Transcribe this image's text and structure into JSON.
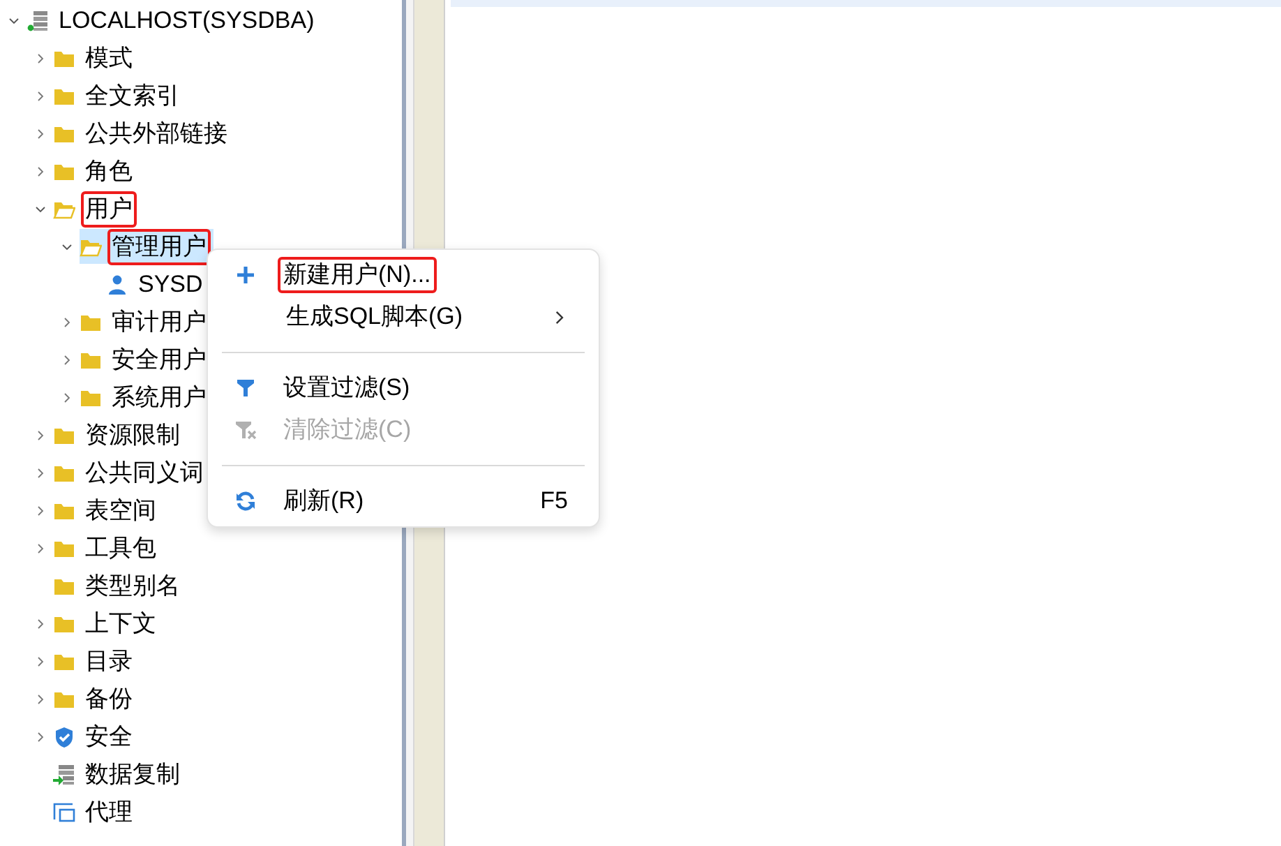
{
  "tree": [
    {
      "label": "LOCALHOST(SYSDBA)",
      "kind": "server",
      "expanded": true,
      "selected": false,
      "annotated": false,
      "children": [
        {
          "label": "模式",
          "kind": "folder",
          "expanded": false,
          "selected": false,
          "annotated": false
        },
        {
          "label": "全文索引",
          "kind": "folder",
          "expanded": false,
          "selected": false,
          "annotated": false
        },
        {
          "label": "公共外部链接",
          "kind": "folder",
          "expanded": false,
          "selected": false,
          "annotated": false
        },
        {
          "label": "角色",
          "kind": "folder",
          "expanded": false,
          "selected": false,
          "annotated": false
        },
        {
          "label": "用户",
          "kind": "folder",
          "expanded": true,
          "selected": false,
          "annotated": true,
          "children": [
            {
              "label": "管理用户",
              "kind": "folder",
              "expanded": true,
              "selected": true,
              "annotated": true,
              "children": [
                {
                  "label": "SYSD",
                  "kind": "user",
                  "selected": false,
                  "annotated": false
                }
              ]
            },
            {
              "label": "审计用户",
              "kind": "folder",
              "expanded": false,
              "selected": false,
              "annotated": false
            },
            {
              "label": "安全用户",
              "kind": "folder",
              "expanded": false,
              "selected": false,
              "annotated": false
            },
            {
              "label": "系统用户",
              "kind": "folder",
              "expanded": false,
              "selected": false,
              "annotated": false
            }
          ]
        },
        {
          "label": "资源限制",
          "kind": "folder",
          "expanded": false,
          "selected": false,
          "annotated": false
        },
        {
          "label": "公共同义词",
          "kind": "folder",
          "expanded": false,
          "selected": false,
          "annotated": false
        },
        {
          "label": "表空间",
          "kind": "folder",
          "expanded": false,
          "selected": false,
          "annotated": false
        },
        {
          "label": "工具包",
          "kind": "folder",
          "expanded": false,
          "selected": false,
          "annotated": false
        },
        {
          "label": "类型别名",
          "kind": "folder",
          "selected": false,
          "annotated": false
        },
        {
          "label": "上下文",
          "kind": "folder",
          "expanded": false,
          "selected": false,
          "annotated": false
        },
        {
          "label": "目录",
          "kind": "folder",
          "expanded": false,
          "selected": false,
          "annotated": false
        },
        {
          "label": "备份",
          "kind": "folder",
          "expanded": false,
          "selected": false,
          "annotated": false
        },
        {
          "label": "安全",
          "kind": "shield",
          "expanded": false,
          "selected": false,
          "annotated": false
        },
        {
          "label": "数据复制",
          "kind": "replication",
          "selected": false,
          "annotated": false
        },
        {
          "label": "代理",
          "kind": "proxy",
          "selected": false,
          "annotated": false
        }
      ]
    }
  ],
  "context_menu": [
    {
      "kind": "command",
      "label": "新建用户(N)...",
      "disabled": false,
      "annotated": true
    },
    {
      "kind": "command",
      "label": "生成SQL脚本(G)",
      "disabled": false,
      "annotated": false,
      "submenu": true
    },
    {
      "kind": "separator"
    },
    {
      "kind": "command",
      "label": "设置过滤(S)",
      "disabled": false,
      "annotated": false
    },
    {
      "kind": "command",
      "label": "清除过滤(C)",
      "disabled": true,
      "annotated": false
    },
    {
      "kind": "separator"
    },
    {
      "kind": "command",
      "label": "刷新(R)",
      "shortcut": "F5",
      "disabled": false,
      "annotated": false
    }
  ]
}
